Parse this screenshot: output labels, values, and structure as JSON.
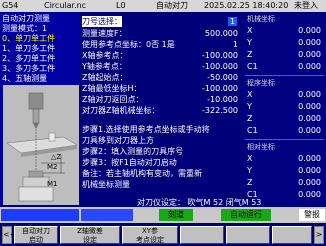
{
  "top_bar": {
    "mode": "G54",
    "program": "Circular.nc",
    "tool": "L0",
    "status": "自动对刀",
    "datetime": "2025.02.25  18:40:20",
    "login": "未登入"
  },
  "left_menu": {
    "title": "自动对刀测量",
    "items": [
      "测量模式：1",
      "0、单刀单工件",
      "1、单刀多工件",
      "2、多刀单工件",
      "3、多刀多工件",
      "4、五轴测量"
    ],
    "selected_index": 1,
    "diagram_labels": {
      "m2": "M2",
      "m1": "M1",
      "dz": "△Z"
    }
  },
  "params": [
    {
      "label": "刀号选择：",
      "value": "1"
    },
    {
      "label": "测量速度F：",
      "value": "500.000"
    },
    {
      "label": "使用参考点坐标：0否 1是",
      "value": "1"
    },
    {
      "label": "X轴参考点：",
      "value": "-100.000"
    },
    {
      "label": "Y轴参考点：",
      "value": "-100.000"
    },
    {
      "label": "Z轴起始点：",
      "value": "-50.000"
    },
    {
      "label": "Z轴最低坐标H：",
      "value": "-100.000"
    },
    {
      "label": "Z轴对刀返回点：",
      "value": "-10.000"
    },
    {
      "label": "对刀器Z轴机械坐标：",
      "value": "-322.500"
    }
  ],
  "steps": [
    "步骤1.选择使用参考点坐标或手动将",
    "刀具移到对刀器上方",
    "步骤2：填入测量的刀具序号",
    "步骤3：按F1自动对刀启动",
    "备注：若主轴机构有变动，需重新",
    "机械坐标测量"
  ],
  "coords": {
    "machine": {
      "title": "机械坐标",
      "rows": [
        {
          "axis": "X",
          "value": "0.000"
        },
        {
          "axis": "Y",
          "value": "0.000"
        },
        {
          "axis": "Z",
          "value": "0.000"
        },
        {
          "axis": "C1",
          "value": "0.000"
        }
      ]
    },
    "program": {
      "title": "程序坐标",
      "rows": [
        {
          "axis": "X",
          "value": "0.000"
        },
        {
          "axis": "Y",
          "value": "0.000"
        },
        {
          "axis": "Z",
          "value": "0.000"
        },
        {
          "axis": "C1",
          "value": "0.000"
        }
      ]
    },
    "relative": {
      "title": "相对坐标",
      "rows": [
        {
          "axis": "X",
          "value": "0.000"
        },
        {
          "axis": "Y",
          "value": "0.000"
        },
        {
          "axis": "Z",
          "value": "0.000"
        },
        {
          "axis": "C1",
          "value": "0.000"
        }
      ]
    }
  },
  "status_strip": {
    "tool_setter": "对刀仪设定： 吹气M",
    "m_code": "52",
    "off_label": "闭气M",
    "off_code": "53",
    "mode_jog": "刻道",
    "auto_run": "自动运行",
    "alarm": "警报"
  },
  "softkeys": [
    {
      "line1": "F1",
      "line2": "自动对刀",
      "line3": "启动"
    },
    {
      "line1": "",
      "line2": "Z轴微差",
      "line3": "设定"
    },
    {
      "line1": "",
      "line2": "XY参",
      "line3": "考点设定"
    }
  ],
  "colors": {
    "background": "#00007a",
    "highlight": "#ffffff",
    "accent": "#ffff00"
  }
}
